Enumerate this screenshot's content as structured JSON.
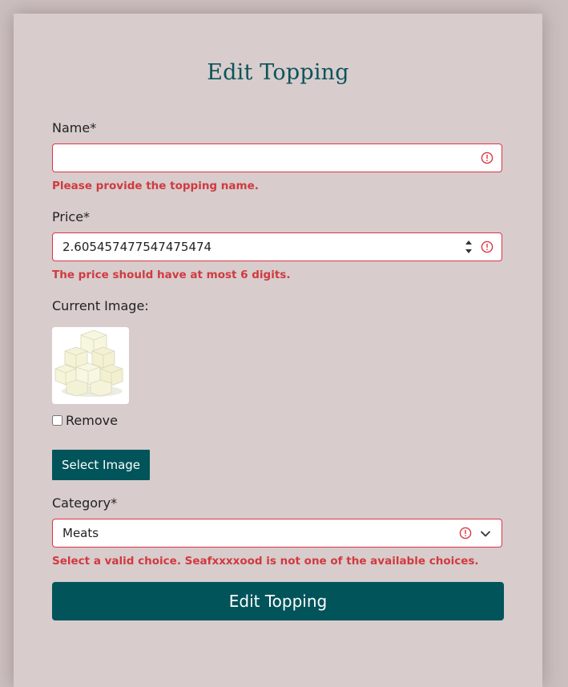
{
  "page": {
    "title": "Edit Topping"
  },
  "form": {
    "name": {
      "label": "Name*",
      "value": "",
      "error": "Please provide the topping name."
    },
    "price": {
      "label": "Price*",
      "value": "2.605457477547475474",
      "error": "The price should have at most 6 digits."
    },
    "image": {
      "label": "Current Image:",
      "remove_label": "Remove",
      "remove_checked": false,
      "select_button": "Select Image"
    },
    "category": {
      "label": "Category*",
      "value": "Meats",
      "error": "Select a valid choice. Seafxxxxood is not one of the available choices."
    },
    "submit_label": "Edit Topping"
  },
  "colors": {
    "accent": "#00545a",
    "error": "#dc3545",
    "card": "#d8cccc",
    "background": "#cbbfbf"
  },
  "icons": {
    "field_error": "exclamation-circle-icon",
    "number_spinner": "up-down-arrows-icon",
    "select_dropdown": "chevron-down-icon"
  }
}
